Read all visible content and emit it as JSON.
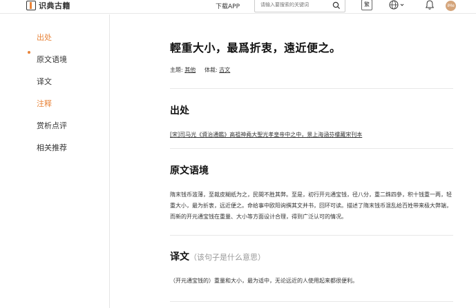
{
  "header": {
    "logo_text": "识典古籍",
    "download_label": "下载APP",
    "search_placeholder": "请输入要搜索的关键词",
    "fan_label": "繁",
    "avatar_text": "iMe"
  },
  "sidebar": {
    "items": [
      {
        "label": "出处",
        "active": true
      },
      {
        "label": "原文语境",
        "active": false
      },
      {
        "label": "译文",
        "active": false
      },
      {
        "label": "注释",
        "active": true
      },
      {
        "label": "赏析点评",
        "active": false
      },
      {
        "label": "相关推荐",
        "active": false
      }
    ]
  },
  "main": {
    "title": "輕重大小，最爲折衷，遠近便之。",
    "meta": {
      "theme_label": "主題:",
      "theme_value": "其他",
      "genre_label": "体裁:",
      "genre_value": "古文"
    },
    "source": {
      "heading": "出处",
      "text": "[宋]司马光《資治通鑑》高祖神堯大聖光孝皇帝中之中，景上海涵芬樓藏宋刊本"
    },
    "context": {
      "heading": "原文语境",
      "text": "隋末钱币滥薄，至裁皮糊纸为之，民間不胜其弊。至是，初行开元通宝钱，径八分，重二銖四參，积十钱重一两，轻重大小，最为折衷，远近便之。命给事中欧阳询撰其文并书，回环可读。描述了隋末钱币混乱给百姓带来极大弊端，而新的开元通宝钱在重量、大小等方面设计合理，得到广泛认可的情况。"
    },
    "translation": {
      "heading": "译文",
      "subheading": "（该句子是什么意思）",
      "text": "（开元通宝钱的）重量和大小，最为适中，无论远近的人使用起来都很便利。"
    }
  },
  "colors": {
    "accent": "#e8843a",
    "text": "#222222",
    "divider": "#e8e8e8"
  }
}
